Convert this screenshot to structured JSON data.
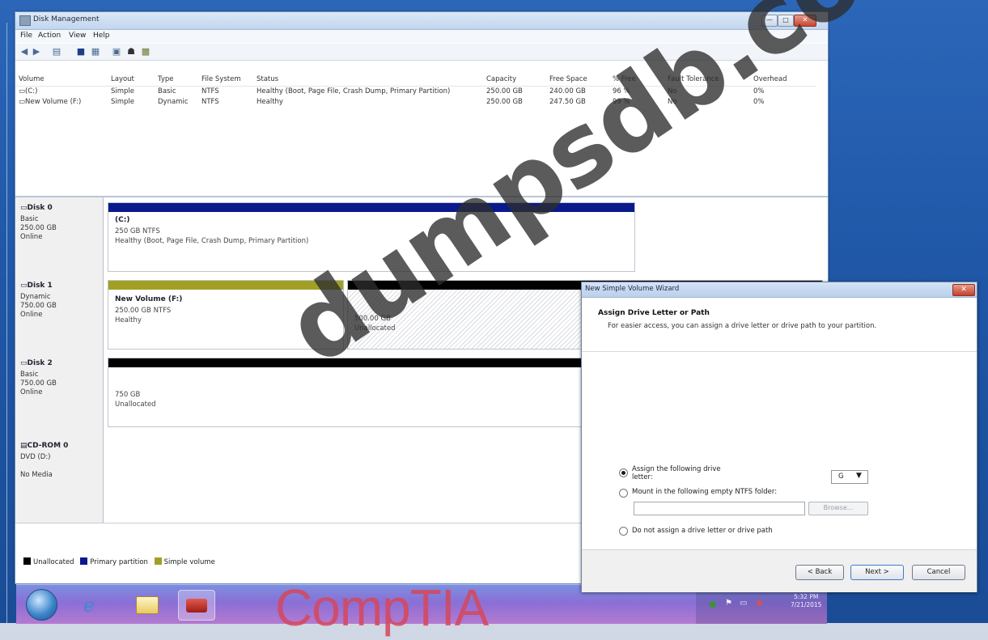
{
  "window": {
    "title": "Disk Management",
    "controls": {
      "minimize": "—",
      "maximize": "□",
      "close": "✕"
    }
  },
  "menu": [
    "File",
    "Action",
    "View",
    "Help"
  ],
  "toolbar_icons": [
    "back-icon",
    "forward-icon",
    "console-icon",
    "properties-icon",
    "list-icon",
    "help-icon",
    "settings-icon",
    "refresh-icon"
  ],
  "volume_list": {
    "columns": [
      "Volume",
      "Layout",
      "Type",
      "File System",
      "Status",
      "Capacity",
      "Free Space",
      "% Free",
      "Fault Tolerance",
      "Overhead"
    ],
    "rows": [
      [
        "(C:)",
        "Simple",
        "Basic",
        "NTFS",
        "Healthy (Boot, Page File, Crash Dump, Primary Partition)",
        "250.00 GB",
        "240.00 GB",
        "96 %",
        "No",
        "0%"
      ],
      [
        "New Volume (F:)",
        "Simple",
        "Dynamic",
        "NTFS",
        "Healthy",
        "250.00 GB",
        "247.50 GB",
        "99 %",
        "No",
        "0%"
      ]
    ]
  },
  "disks": [
    {
      "name": "Disk 0",
      "type": "Basic",
      "size": "250.00 GB",
      "state": "Online",
      "partition": {
        "label": "(C:)",
        "detail": "250 GB NTFS",
        "status": "Healthy (Boot, Page File, Crash Dump, Primary Partition)"
      }
    },
    {
      "name": "Disk 1",
      "type": "Dynamic",
      "size": "750.00 GB",
      "state": "Online",
      "partition": {
        "label": "New Volume (F:)",
        "detail": "250.00 GB NTFS",
        "status": "Healthy"
      },
      "unallocated": {
        "size": "500.00 GB",
        "label": "Unallocated"
      }
    },
    {
      "name": "Disk 2",
      "type": "Basic",
      "size": "750.00 GB",
      "state": "Online",
      "unallocated": {
        "size": "750 GB",
        "label": "Unallocated"
      }
    },
    {
      "name": "CD-ROM 0",
      "type": "DVD (D:)",
      "state": "No Media"
    }
  ],
  "legend": [
    {
      "label": "Unallocated",
      "color": "#000000"
    },
    {
      "label": "Primary partition",
      "color": "#0a1a8c"
    },
    {
      "label": "Simple volume",
      "color": "#a1a025"
    }
  ],
  "taskbar": {
    "apps": [
      "start-orb",
      "internet-explorer-icon",
      "explorer-icon",
      "toolbox-icon"
    ],
    "clock_time": "5:32 PM",
    "clock_date": "7/21/2015"
  },
  "wizard": {
    "title": "New Simple Volume Wizard",
    "close": "✕",
    "heading": "Assign Drive Letter or Path",
    "subheading": "For easier access, you can assign a drive letter or drive path to your partition.",
    "options": {
      "assign_letter": "Assign the following drive letter:",
      "mount_folder": "Mount in the following empty NTFS folder:",
      "no_assign": "Do not assign a drive letter or drive path"
    },
    "selected_letter": "G",
    "folder_value": "",
    "browse": "Browse...",
    "buttons": {
      "back": "< Back",
      "next": "Next >",
      "cancel": "Cancel"
    }
  },
  "watermark": "dumpsdb.com",
  "brand": "CompTIA",
  "colors": {
    "primary_partition": "#0a1a8c",
    "simple_volume": "#a1a025",
    "unallocated": "#000000",
    "taskbar": "#8a6fd6"
  }
}
